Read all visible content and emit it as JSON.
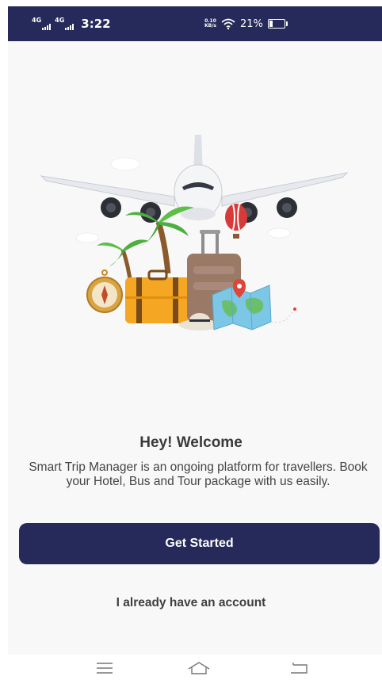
{
  "status_bar": {
    "net1": "4G",
    "net2": "4G",
    "time": "3:22",
    "speed_value": "0.10",
    "speed_unit": "KB/s",
    "battery_text": "21%",
    "battery_level": 0.21,
    "background": "#252a5a"
  },
  "welcome": {
    "title": "Hey! Welcome",
    "body": "Smart Trip Manager is an ongoing platform for travellers. Book your Hotel, Bus and Tour package with us easily."
  },
  "actions": {
    "get_started": "Get Started",
    "existing_account": "I already have an account"
  },
  "nav": {
    "menu_icon": "menu-icon",
    "home_icon": "home-icon",
    "back_icon": "back-icon"
  },
  "colors": {
    "primary": "#252a5a",
    "screen_bg": "#f8f8f8",
    "title_text": "#3a3a3a"
  }
}
